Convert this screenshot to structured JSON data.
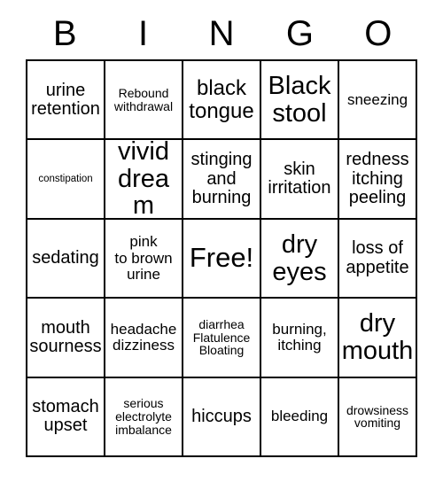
{
  "card": {
    "title": "BINGO",
    "header_letters": [
      "B",
      "I",
      "N",
      "G",
      "O"
    ],
    "free_space_label": "Free!",
    "rows": [
      [
        {
          "text": "urine\nretention",
          "size": "fs-lg"
        },
        {
          "text": "Rebound\nwithdrawal",
          "size": "fs-sm"
        },
        {
          "text": "black\ntongue",
          "size": "fs-xl"
        },
        {
          "text": "Black\nstool",
          "size": "fs-xxl"
        },
        {
          "text": "sneezing",
          "size": "fs-md"
        }
      ],
      [
        {
          "text": "constipation",
          "size": "fs-xs"
        },
        {
          "text": "vivid\ndream",
          "size": "fs-xxl"
        },
        {
          "text": "stinging\nand\nburning",
          "size": "fs-lg"
        },
        {
          "text": "skin\nirritation",
          "size": "fs-lg"
        },
        {
          "text": "redness\nitching\npeeling",
          "size": "fs-lg"
        }
      ],
      [
        {
          "text": "sedating",
          "size": "fs-lg"
        },
        {
          "text": "pink\nto brown\nurine",
          "size": "fs-md"
        },
        {
          "text": "Free!",
          "size": "fs-free"
        },
        {
          "text": "dry\neyes",
          "size": "fs-xxl"
        },
        {
          "text": "loss of\nappetite",
          "size": "fs-lg"
        }
      ],
      [
        {
          "text": "mouth\nsourness",
          "size": "fs-lg"
        },
        {
          "text": "headache\ndizziness",
          "size": "fs-md"
        },
        {
          "text": "diarrhea\nFlatulence\nBloating",
          "size": "fs-sm"
        },
        {
          "text": "burning,\nitching",
          "size": "fs-md"
        },
        {
          "text": "dry\nmouth",
          "size": "fs-xxl"
        }
      ],
      [
        {
          "text": "stomach\nupset",
          "size": "fs-lg"
        },
        {
          "text": "serious\nelectrolyte\nimbalance",
          "size": "fs-sm"
        },
        {
          "text": "hiccups",
          "size": "fs-lg"
        },
        {
          "text": "bleeding",
          "size": "fs-md"
        },
        {
          "text": "drowsiness\nvomiting",
          "size": "fs-sm"
        }
      ]
    ],
    "colors": {
      "background": "#ffffff",
      "text": "#000000",
      "grid_line": "#000000"
    }
  }
}
